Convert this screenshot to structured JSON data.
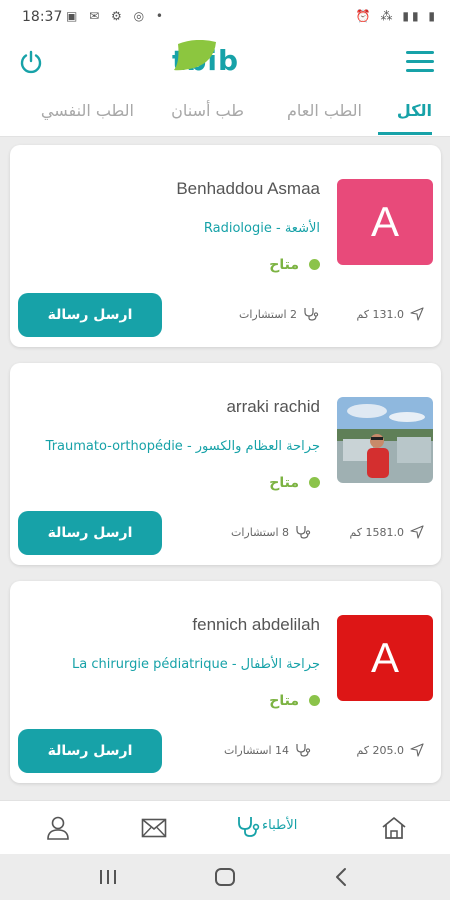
{
  "status_bar": {
    "time": "18:37",
    "left_icons": "▣ ✉ ⚙ ◎ •",
    "right_icons": "⏰ ⁂ ▮▮ ▮"
  },
  "header": {
    "logo_text": "tbib",
    "logo_badge": "24"
  },
  "tabs": [
    {
      "label": "الكل",
      "active": true
    },
    {
      "label": "الطب العام",
      "active": false
    },
    {
      "label": "طب أسنان",
      "active": false
    },
    {
      "label": "الطب النفسي",
      "active": false
    }
  ],
  "doctors": [
    {
      "name": "Benhaddou Asmaa",
      "specialty": "Radiologie - الأشعة",
      "status": "متاح",
      "distance": "131.0 كم",
      "consultations": "2 استشارات",
      "message_button": "ارسل رسالة",
      "avatar_letter": "A",
      "avatar_color": "#e84a7a"
    },
    {
      "name": "arraki rachid",
      "specialty": "Traumato-orthopédie - جراحة العظام والكسور",
      "status": "متاح",
      "distance": "1581.0 كم",
      "consultations": "8 استشارات",
      "message_button": "ارسل رسالة",
      "avatar_letter": "",
      "avatar_color": ""
    },
    {
      "name": "fennich abdelilah",
      "specialty": "La chirurgie pédiatrique - جراحة الأطفال",
      "status": "متاح",
      "distance": "205.0 كم",
      "consultations": "14 استشارات",
      "message_button": "ارسل رسالة",
      "avatar_letter": "A",
      "avatar_color": "#dd1616"
    }
  ],
  "bottom_nav": {
    "doctors_label": "الأطباء"
  },
  "colors": {
    "accent": "#17a2a8",
    "available": "#8bc34a",
    "logo_badge": "#8cc63f"
  }
}
